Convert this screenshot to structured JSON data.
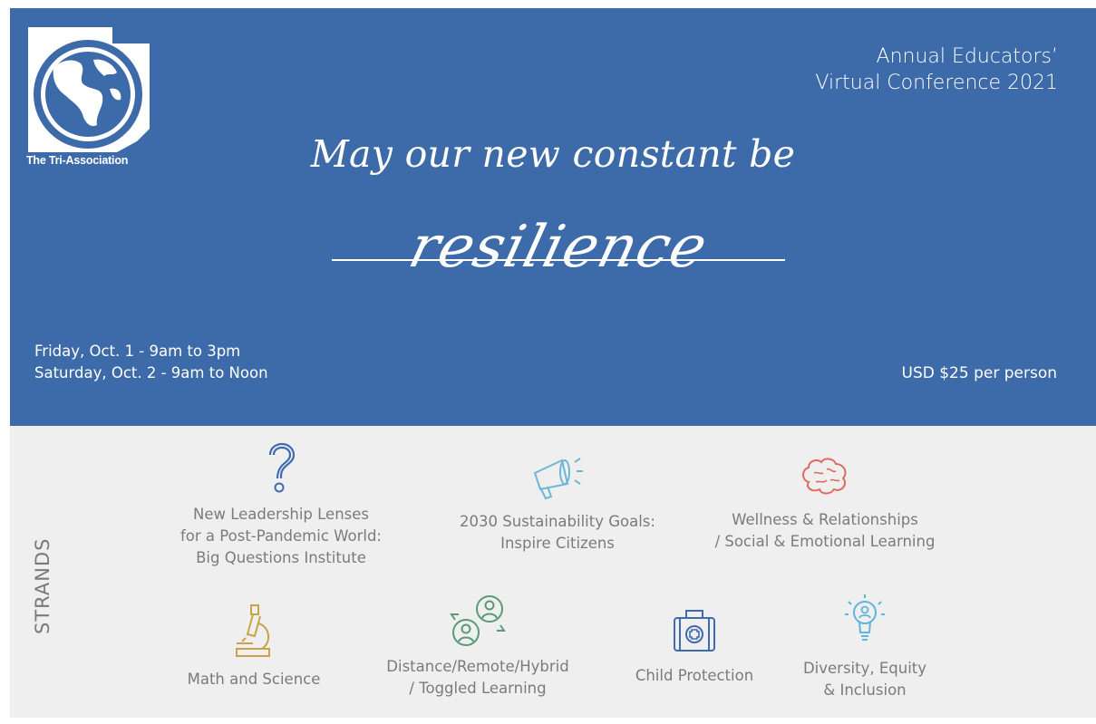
{
  "banner": {
    "logo_text": "The Tri-Association",
    "conference": [
      "Annual Educators’",
      "Virtual Conference 2021"
    ],
    "tagline": "May our new constant be",
    "highlight": "resilience",
    "dates": [
      "Friday, Oct. 1 - 9am to 3pm",
      "Saturday, Oct. 2 - 9am to Noon"
    ],
    "price": "USD $25 per person",
    "colors": {
      "background": "#3d6aa9",
      "text": "#ffffff"
    }
  },
  "strands": {
    "heading": "STRANDS",
    "items": [
      {
        "icon": "question-mark-icon",
        "color": "#3f6bb0",
        "lines": [
          "New Leadership Lenses",
          "for a Post-Pandemic World:",
          "Big Questions Institute"
        ]
      },
      {
        "icon": "megaphone-icon",
        "color": "#6fb7d6",
        "lines": [
          "2030 Sustainability Goals:",
          "Inspire Citizens"
        ]
      },
      {
        "icon": "brain-icon",
        "color": "#e06a5e",
        "lines": [
          "Wellness & Relationships",
          "/ Social & Emotional Learning"
        ]
      },
      {
        "icon": "microscope-icon",
        "color": "#c9a34a",
        "lines": [
          "Math and Science"
        ]
      },
      {
        "icon": "people-exchange-icon",
        "color": "#5a9a7a",
        "lines": [
          "Distance/Remote/Hybrid",
          "/ Toggled Learning"
        ]
      },
      {
        "icon": "first-aid-kit-icon",
        "color": "#3f6bb0",
        "lines": [
          "Child Protection"
        ]
      },
      {
        "icon": "lightbulb-person-icon",
        "color": "#5fb6dc",
        "lines": [
          "Diversity, Equity",
          "& Inclusion"
        ]
      }
    ]
  }
}
